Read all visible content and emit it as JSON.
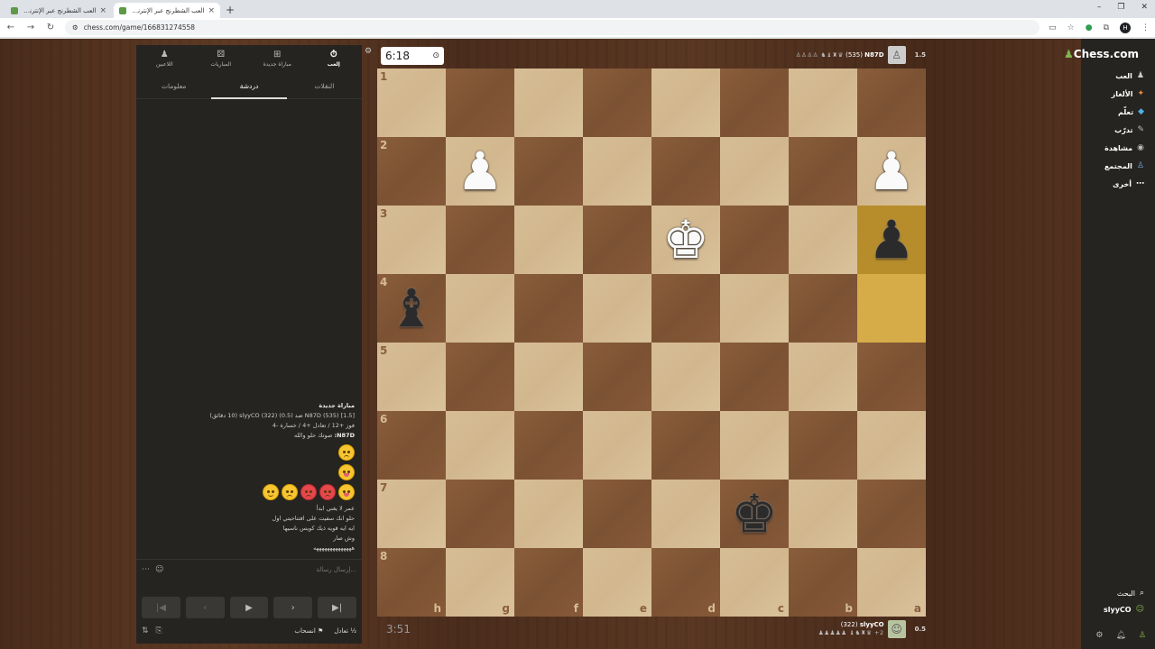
{
  "browser": {
    "tabs": [
      {
        "title": "العب الشطرنج عبر الإنترنت مجانًا",
        "active": false
      },
      {
        "title": "العب الشطرنج عبر الإنترنت مجانًا",
        "active": true
      }
    ],
    "url": "chess.com/game/166831274558"
  },
  "panel": {
    "nav": [
      {
        "label": "إلعب",
        "icon": "⏱",
        "active": true
      },
      {
        "label": "مباراة جديدة",
        "icon": "⊞",
        "active": false
      },
      {
        "label": "المباريات",
        "icon": "⚄",
        "active": false
      },
      {
        "label": "اللاعبين",
        "icon": "♟",
        "active": false
      }
    ],
    "tabs": [
      {
        "label": "النقلات",
        "active": false
      },
      {
        "label": "دردشة",
        "active": true
      },
      {
        "label": "معلومات",
        "active": false
      }
    ],
    "chat": {
      "heading": "مباراة جديدة",
      "line1": "[1.5] (535) N87D ضد (0.5) (322) slyyCO (10 دقائق)",
      "line2": "فوز +12 / تعادل +4 / خسارة -4",
      "msg1_name": "N87D:",
      "msg1_text": "صوتك حلو والله",
      "msg2": "عمر لا يغني ابدأ",
      "msg3": "حلو انك سفيت على افتتاحيتي اول",
      "msg4": "ايه ايه قويه ذيك كويس ناسيها",
      "msg5": "وش صار",
      "msg6": "ههههههههههههههه"
    },
    "input_placeholder": "إرسال رسالة...",
    "footer": {
      "draw": "تعادل",
      "resign": "انسحاب",
      "draw_icon": "½"
    }
  },
  "game": {
    "top_clock": "6:18",
    "bottom_clock": "3:51",
    "top_player": {
      "name": "N87D",
      "rating": "(535)",
      "score": "1.5",
      "captured": "♙♙♙♙ ♞♝♜♛"
    },
    "bottom_player": {
      "name": "slyyCO",
      "rating": "(322)",
      "score": "0.5",
      "captured": "♟♟♟♟♟ ♝♞♜♛ +2"
    },
    "files": [
      "h",
      "g",
      "f",
      "e",
      "d",
      "c",
      "b",
      "a"
    ],
    "ranks": [
      "1",
      "2",
      "3",
      "4",
      "5",
      "6",
      "7",
      "8"
    ],
    "pieces": [
      {
        "square": "g2",
        "glyph": "♟",
        "color": "white"
      },
      {
        "square": "a2",
        "glyph": "♟",
        "color": "white"
      },
      {
        "square": "d3",
        "glyph": "♚",
        "color": "white"
      },
      {
        "square": "a3",
        "glyph": "♟",
        "color": "black"
      },
      {
        "square": "h4",
        "glyph": "♝",
        "color": "black"
      },
      {
        "square": "c7",
        "glyph": "♚",
        "color": "black"
      }
    ],
    "highlighted": [
      "a3",
      "a4"
    ]
  },
  "rightnav": {
    "logo": "Chess.com",
    "items": [
      {
        "label": "العب",
        "icon": "♟"
      },
      {
        "label": "الألغاز",
        "icon": "✦"
      },
      {
        "label": "تعلّم",
        "icon": "◆"
      },
      {
        "label": "تدرّب",
        "icon": "✎"
      },
      {
        "label": "مشاهدة",
        "icon": "◉"
      },
      {
        "label": "المجتمع",
        "icon": "♙"
      },
      {
        "label": "أخرى",
        "icon": "⋯"
      }
    ],
    "search": "البحث",
    "user": "slyyCO"
  }
}
